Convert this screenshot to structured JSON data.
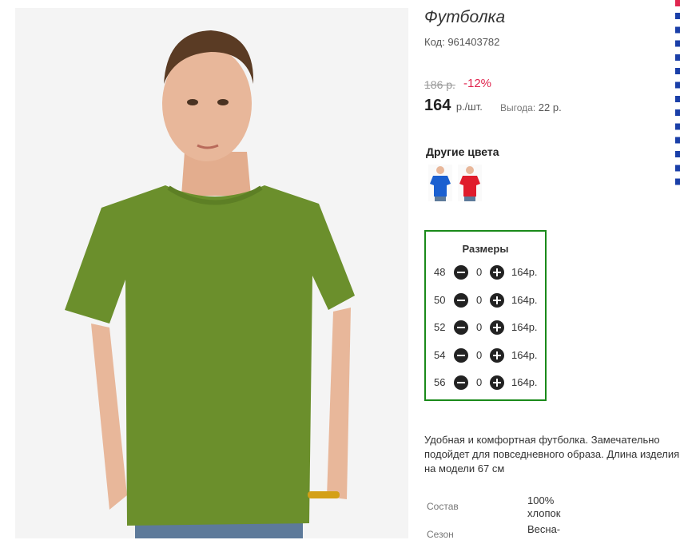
{
  "product": {
    "title": "Футболка",
    "code": "Код: 961403782",
    "old_price": "186 р.",
    "discount": "-12%",
    "price": "164",
    "price_unit": "р./шт.",
    "benefit_label": "Выгода:",
    "benefit_value": "22 р."
  },
  "other_colors": {
    "heading": "Другие цвета",
    "items": [
      {
        "name": "blue-tshirt",
        "color": "#1a5fd0"
      },
      {
        "name": "red-tshirt",
        "color": "#e01c2c"
      }
    ]
  },
  "sizes": {
    "heading": "Размеры",
    "rows": [
      {
        "size": "48",
        "qty": "0",
        "price": "164р."
      },
      {
        "size": "50",
        "qty": "0",
        "price": "164р."
      },
      {
        "size": "52",
        "qty": "0",
        "price": "164р."
      },
      {
        "size": "54",
        "qty": "0",
        "price": "164р."
      },
      {
        "size": "56",
        "qty": "0",
        "price": "164р."
      }
    ]
  },
  "description": "Удобная и комфортная футболка. Замечательно подойдет для повседневного образа. Длина изделия на модели 67 см",
  "specs": [
    {
      "label": "Состав",
      "value": "100% хлопок"
    },
    {
      "label": "Сезон",
      "value": "Весна-"
    }
  ],
  "colors": {
    "sizes_border": "#1a8a1a",
    "discount": "#e0264f",
    "tshirt": "#6b8f2c"
  }
}
